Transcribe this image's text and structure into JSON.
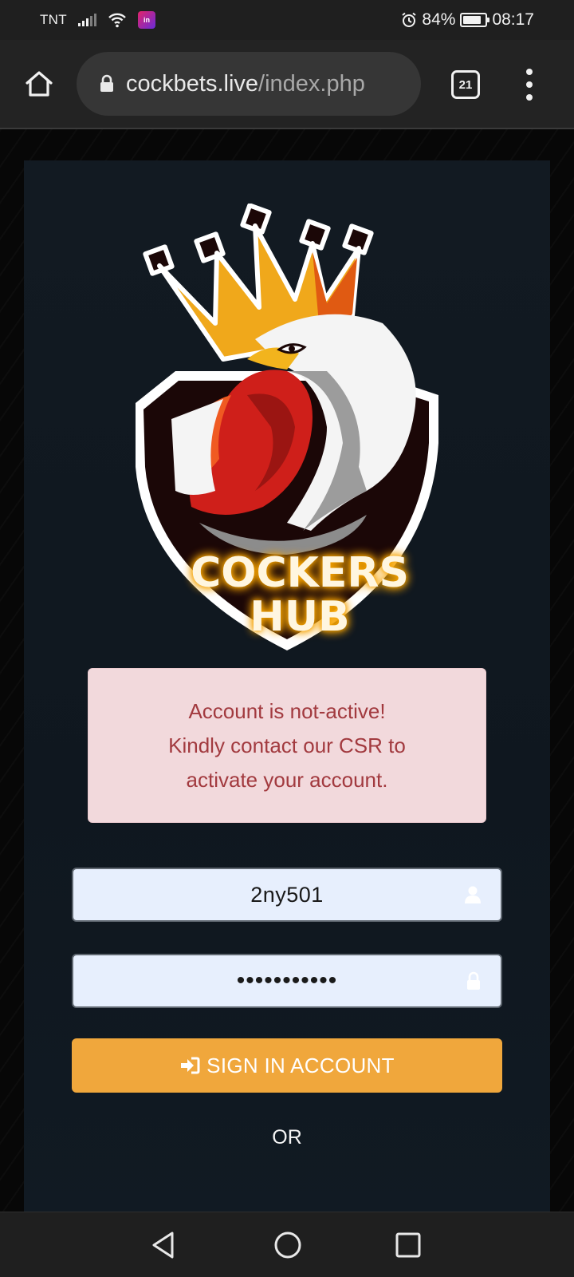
{
  "status_bar": {
    "carrier": "TNT",
    "battery_percent": "84%",
    "battery_level": 0.84,
    "time": "08:17",
    "icons": [
      "signal-icon",
      "wifi-icon",
      "app-notification-icon",
      "alarm-icon",
      "battery-icon"
    ]
  },
  "browser": {
    "url_domain": "cockbets.live",
    "url_path": "/index.php",
    "tab_count": "21",
    "icons": [
      "home-icon",
      "lock-icon",
      "tabs-icon",
      "more-vert-icon"
    ]
  },
  "logo": {
    "line1": "COCKERS",
    "line2": "HUB"
  },
  "alert": {
    "line1": "Account is not-active!",
    "line2": "Kindly contact our CSR to",
    "line3": "activate your account."
  },
  "form": {
    "username_value": "2ny501",
    "password_value": "•••••••••••",
    "signin_label": "SIGN IN ACCOUNT",
    "or_text": "OR"
  },
  "colors": {
    "accent": "#f0a73c",
    "alert_bg": "#f2d9dc",
    "alert_text": "#a23a3f",
    "card_bg": "#121a22",
    "input_bg": "#e7effd"
  },
  "nav_bar": {
    "icons": [
      "back-icon",
      "home-circle-icon",
      "recents-icon"
    ]
  }
}
